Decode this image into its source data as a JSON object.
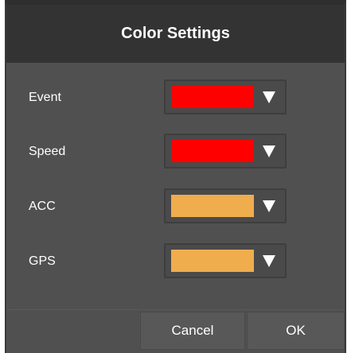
{
  "dialog": {
    "title": "Color Settings"
  },
  "settings": [
    {
      "label": "Event",
      "color": "#ff0000"
    },
    {
      "label": "Speed",
      "color": "#ff0000"
    },
    {
      "label": "ACC",
      "color": "#f0ad4e"
    },
    {
      "label": "GPS",
      "color": "#f0ad4e"
    }
  ],
  "buttons": {
    "cancel_label": "Cancel",
    "ok_label": "OK"
  },
  "icons": {
    "dropdown": "chevron-down-icon"
  }
}
